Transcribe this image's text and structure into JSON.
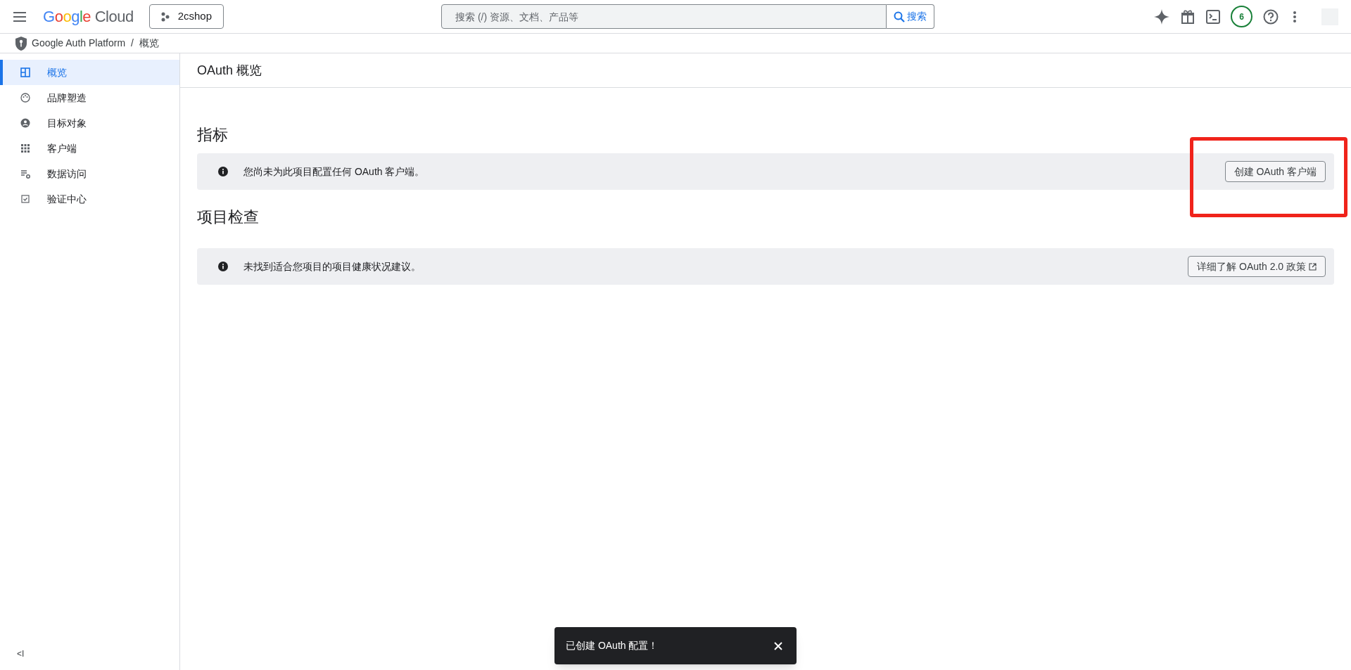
{
  "topbar": {
    "logo": "Google Cloud",
    "project": "2cshop",
    "search": {
      "placeholder": "搜索 (/) 资源、文档、产品等",
      "button": "搜索"
    },
    "notifications": "6"
  },
  "breadcrumb": {
    "items": [
      "Google Auth Platform",
      "概览"
    ],
    "separator": "/"
  },
  "sidebar": {
    "items": [
      {
        "label": "概览",
        "kind": "dashboard",
        "selected": true
      },
      {
        "label": "品牌塑造",
        "kind": "palette",
        "selected": false
      },
      {
        "label": "目标对象",
        "kind": "person",
        "selected": false
      },
      {
        "label": "客户端",
        "kind": "grid",
        "selected": false
      },
      {
        "label": "数据访问",
        "kind": "settings",
        "selected": false
      },
      {
        "label": "验证中心",
        "kind": "check",
        "selected": false
      }
    ],
    "collapse": "<I"
  },
  "page_title": "OAuth 概览",
  "sections": [
    {
      "heading": "指标",
      "message": "您尚未为此项目配置任何 OAuth 客户端。",
      "button": "创建 OAuth 客户端",
      "external": false,
      "highlighted": true
    },
    {
      "heading": "项目检查",
      "message": "未找到适合您项目的项目健康状况建议。",
      "button": "详细了解 OAuth 2.0 政策",
      "external": true,
      "highlighted": false
    }
  ],
  "toast": {
    "message": "已创建 OAuth 配置！"
  }
}
